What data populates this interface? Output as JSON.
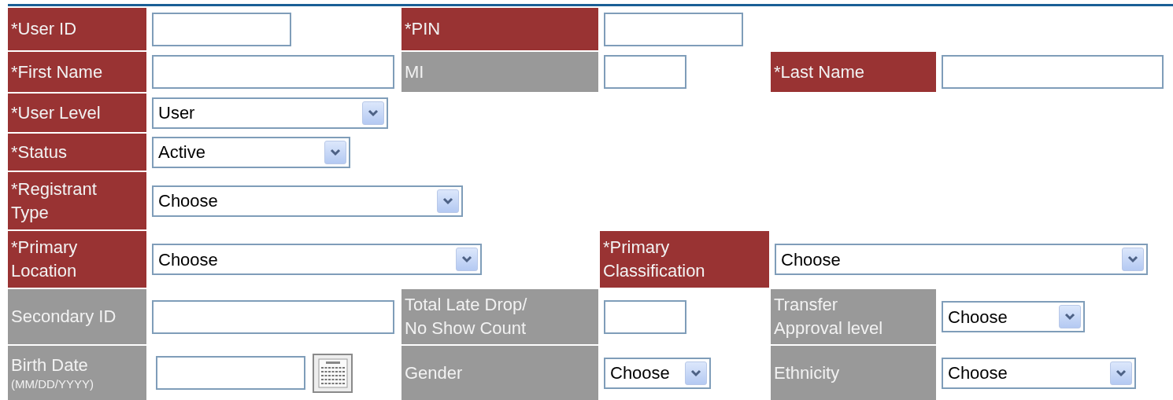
{
  "rows": [
    {
      "cells": [
        {
          "kind": "label",
          "text": "*User ID",
          "required": true
        },
        {
          "kind": "input"
        },
        {
          "kind": "label",
          "text": "*PIN",
          "required": true
        },
        {
          "kind": "input"
        }
      ]
    },
    {
      "cells": [
        {
          "kind": "label",
          "text": "*First Name",
          "required": true
        },
        {
          "kind": "input"
        },
        {
          "kind": "label",
          "text": "MI",
          "required": false
        },
        {
          "kind": "input"
        },
        {
          "kind": "label",
          "text": "*Last Name",
          "required": true
        },
        {
          "kind": "input"
        }
      ]
    },
    {
      "cells": [
        {
          "kind": "label",
          "text": "*User Level",
          "required": true
        },
        {
          "kind": "select",
          "value": "User"
        }
      ]
    },
    {
      "cells": [
        {
          "kind": "label",
          "text": "*Status",
          "required": true
        },
        {
          "kind": "select",
          "value": "Active"
        }
      ]
    },
    {
      "cells": [
        {
          "kind": "label",
          "text": "*Registrant\nType",
          "required": true
        },
        {
          "kind": "select",
          "value": "Choose"
        }
      ]
    },
    {
      "cells": [
        {
          "kind": "label",
          "text": "*Primary\nLocation",
          "required": true
        },
        {
          "kind": "select",
          "value": "Choose"
        },
        {
          "kind": "empty"
        },
        {
          "kind": "label",
          "text": "*Primary\nClassification",
          "required": true
        },
        {
          "kind": "select",
          "value": "Choose"
        }
      ]
    },
    {
      "cells": [
        {
          "kind": "label",
          "text": "Secondary ID",
          "required": false
        },
        {
          "kind": "input"
        },
        {
          "kind": "label",
          "text": "Total Late Drop/\nNo Show Count",
          "required": false
        },
        {
          "kind": "input"
        },
        {
          "kind": "label",
          "text": "Transfer\nApproval level",
          "required": false
        },
        {
          "kind": "select",
          "value": "Choose"
        }
      ]
    },
    {
      "cells": [
        {
          "kind": "label",
          "text": "Birth Date",
          "hint": "(MM/DD/YYYY)",
          "required": false
        },
        {
          "kind": "date"
        },
        {
          "kind": "label",
          "text": "Gender",
          "required": false
        },
        {
          "kind": "select",
          "value": "Choose"
        },
        {
          "kind": "label",
          "text": "Ethnicity",
          "required": false
        },
        {
          "kind": "select",
          "value": "Choose"
        }
      ]
    }
  ]
}
